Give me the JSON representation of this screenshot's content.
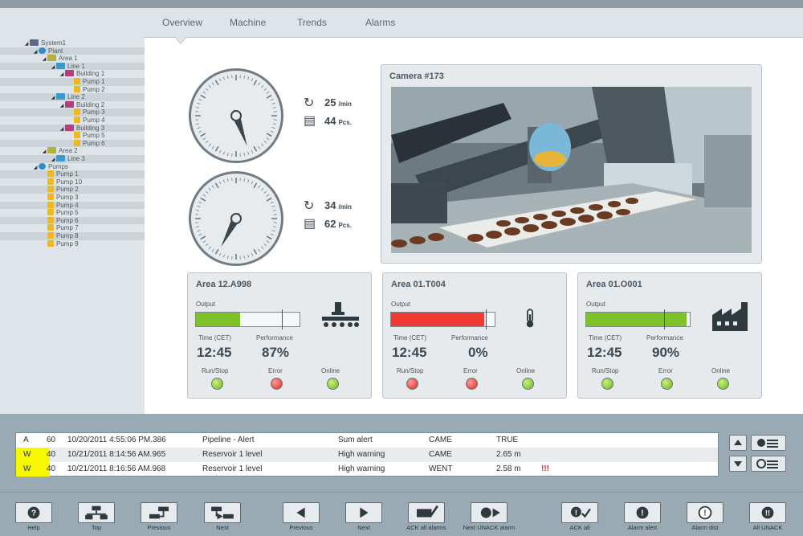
{
  "tabs": [
    "Overview",
    "Machine",
    "Trends",
    "Alarms"
  ],
  "tree": [
    {
      "label": "System1",
      "icon": "sys",
      "indent": 0
    },
    {
      "label": "Plant",
      "icon": "plant",
      "indent": 1
    },
    {
      "label": "Area 1",
      "icon": "area",
      "indent": 2
    },
    {
      "label": "Line 1",
      "icon": "line",
      "indent": 3
    },
    {
      "label": "Building 1",
      "icon": "bld",
      "indent": 4
    },
    {
      "label": "Pump 1",
      "icon": "pump",
      "indent": 5
    },
    {
      "label": "Pump 2",
      "icon": "pump",
      "indent": 5
    },
    {
      "label": "Line 2",
      "icon": "line",
      "indent": 3
    },
    {
      "label": "Building 2",
      "icon": "bld",
      "indent": 4
    },
    {
      "label": "Pump 3",
      "icon": "pump",
      "indent": 5
    },
    {
      "label": "Pump 4",
      "icon": "pump",
      "indent": 5
    },
    {
      "label": "Building 3",
      "icon": "bld",
      "indent": 4
    },
    {
      "label": "Pump 5",
      "icon": "pump",
      "indent": 5
    },
    {
      "label": "Pump 6",
      "icon": "pump",
      "indent": 5
    },
    {
      "label": "Area 2",
      "icon": "area",
      "indent": 2
    },
    {
      "label": "Line 3",
      "icon": "line",
      "indent": 3
    },
    {
      "label": "Pumps",
      "icon": "plant",
      "indent": 1
    },
    {
      "label": "Pump 1",
      "icon": "pump",
      "indent": 2
    },
    {
      "label": "Pump 10",
      "icon": "pump",
      "indent": 2
    },
    {
      "label": "Pump 2",
      "icon": "pump",
      "indent": 2
    },
    {
      "label": "Pump 3",
      "icon": "pump",
      "indent": 2
    },
    {
      "label": "Pump 4",
      "icon": "pump",
      "indent": 2
    },
    {
      "label": "Pump 5",
      "icon": "pump",
      "indent": 2
    },
    {
      "label": "Pump 6",
      "icon": "pump",
      "indent": 2
    },
    {
      "label": "Pump 7",
      "icon": "pump",
      "indent": 2
    },
    {
      "label": "Pump 8",
      "icon": "pump",
      "indent": 2
    },
    {
      "label": "Pump 9",
      "icon": "pump",
      "indent": 2
    }
  ],
  "gauges": [
    {
      "rate": "25",
      "rate_unit": "/min",
      "count": "44",
      "count_unit": "Pcs.",
      "needle_deg": 160
    },
    {
      "rate": "34",
      "rate_unit": "/min",
      "count": "62",
      "count_unit": "Pcs.",
      "needle_deg": 208
    }
  ],
  "camera": {
    "title": "Camera #173"
  },
  "cards": [
    {
      "title": "Area 12.A998",
      "output_label": "Output",
      "output_fraction": 0.43,
      "bar_color": "#7ec22a",
      "time_label": "Time (CET)",
      "perf_label": "Performance",
      "time": "12:45",
      "performance": "87%",
      "runstop_label": "Run/Stop",
      "error_label": "Error",
      "online_label": "Online",
      "runstop": "green",
      "error": "red",
      "online": "green",
      "icon": "conveyor-icon"
    },
    {
      "title": "Area 01.T004",
      "output_label": "Output",
      "output_fraction": 0.9,
      "bar_color": "#f03a34",
      "time_label": "Time (CET)",
      "perf_label": "Performance",
      "time": "12:45",
      "performance": "0%",
      "runstop_label": "Run/Stop",
      "error_label": "Error",
      "online_label": "Online",
      "runstop": "red",
      "error": "red",
      "online": "green",
      "icon": "thermometer-icon"
    },
    {
      "title": "Area 01.O001",
      "output_label": "Output",
      "output_fraction": 0.97,
      "bar_color": "#7ec22a",
      "time_label": "Time (CET)",
      "perf_label": "Performance",
      "time": "12:45",
      "performance": "90%",
      "runstop_label": "Run/Stop",
      "error_label": "Error",
      "online_label": "Online",
      "runstop": "green",
      "error": "green",
      "online": "green",
      "icon": "factory-icon"
    }
  ],
  "alarms": [
    {
      "type": "A",
      "prio": "60",
      "datetime": "10/20/2011 4:55:06 PM.386",
      "source": "Pipeline - Alert",
      "text": "Sum alert",
      "state": "CAME",
      "value": "TRUE",
      "highlight": false,
      "flag": ""
    },
    {
      "type": "W",
      "prio": "40",
      "datetime": "10/21/2011 8:14:56 AM.965",
      "source": "Reservoir 1 level",
      "text": "High warning",
      "state": "CAME",
      "value": "2.65 m",
      "highlight": true,
      "flag": ""
    },
    {
      "type": "W",
      "prio": "40",
      "datetime": "10/21/2011 8:16:56 AM.968",
      "source": "Reservoir 1 level",
      "text": "High warning",
      "state": "WENT",
      "value": "2.58 m",
      "highlight": true,
      "flag": "!!!"
    }
  ],
  "toolbar": [
    {
      "label": "Help",
      "icon": "help-icon"
    },
    {
      "label": "Top",
      "icon": "top-icon"
    },
    {
      "label": "Previous",
      "icon": "hierarchy-previous-icon"
    },
    {
      "label": "Next",
      "icon": "hierarchy-next-icon"
    },
    {
      "label": "Previous",
      "icon": "arrow-left-icon"
    },
    {
      "label": "Next",
      "icon": "arrow-right-icon"
    },
    {
      "label": "ACK all alarms",
      "icon": "ack-all-icon"
    },
    {
      "label": "Next UNACK alarm",
      "icon": "next-unack-icon"
    },
    {
      "label": "ACK all",
      "icon": "ack-icon"
    },
    {
      "label": "Alarm alert",
      "icon": "alarm-alert-icon"
    },
    {
      "label": "Alarm dist",
      "icon": "alarm-dist-icon"
    },
    {
      "label": "All UNACK",
      "icon": "all-unack-icon"
    }
  ]
}
